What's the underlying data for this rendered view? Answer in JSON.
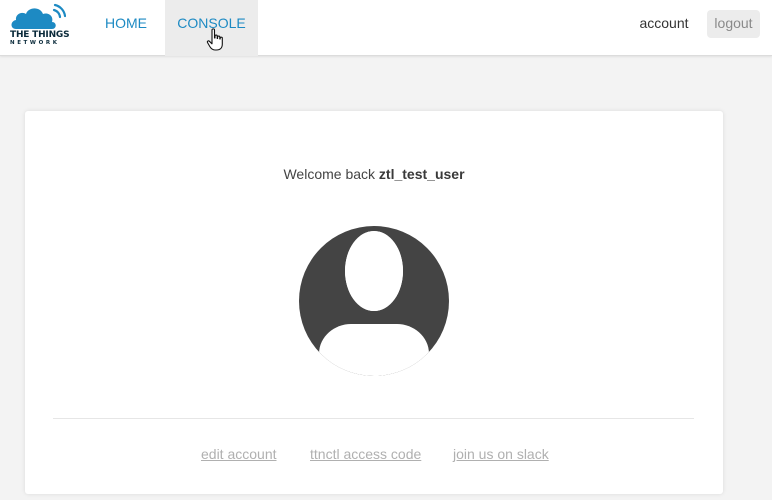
{
  "header": {
    "logo": {
      "line1": "THE THINGS",
      "line2": "NETWORK"
    },
    "nav": {
      "home_label": "HOME",
      "console_label": "CONSOLE"
    },
    "account_label": "account",
    "logout_label": "logout"
  },
  "main": {
    "welcome_prefix": "Welcome back",
    "username": "ztl_test_user",
    "footer_links": {
      "edit_account": "edit account",
      "ttnctl_access_code": "ttnctl access code",
      "join_slack": "join us on slack"
    }
  },
  "colors": {
    "accent": "#1d8ac3",
    "avatar": "#444444",
    "link_muted": "#b0b0b0"
  }
}
